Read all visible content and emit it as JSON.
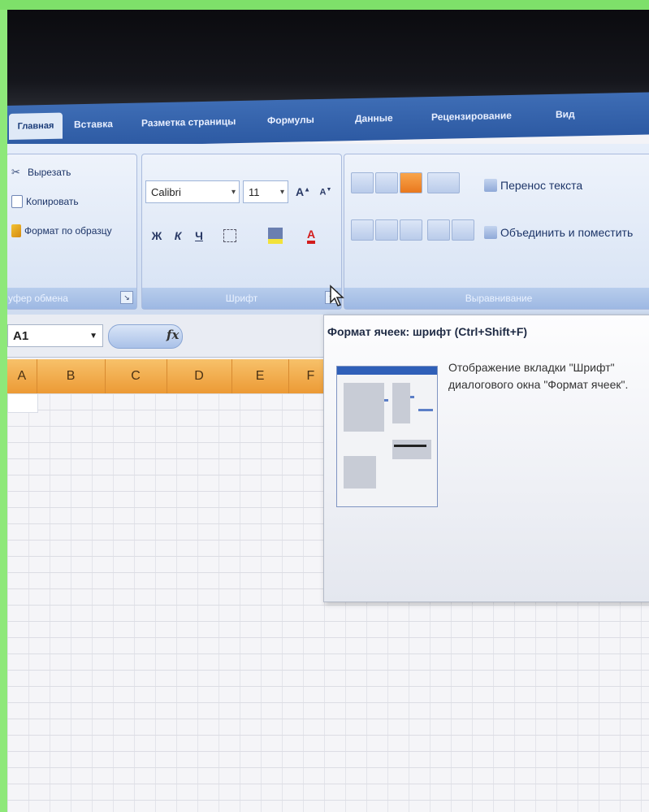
{
  "tabs": [
    {
      "label": "Главная",
      "active": true
    },
    {
      "label": "Вставка"
    },
    {
      "label": "Разметка страницы"
    },
    {
      "label": "Формулы"
    },
    {
      "label": "Данные"
    },
    {
      "label": "Рецензирование"
    },
    {
      "label": "Вид"
    }
  ],
  "clipboard": {
    "cut": "Вырезать",
    "copy": "Копировать",
    "format_painter": "Формат по образцу",
    "group_label": "уфер обмена"
  },
  "font": {
    "font_name": "Calibri",
    "font_size": "11",
    "group_label": "Шрифт",
    "bold": "Ж",
    "italic": "К",
    "underline": "Ч"
  },
  "alignment": {
    "wrap_text": "Перенос текста",
    "merge_center": "Объединить и поместить",
    "group_label": "Выравнивание"
  },
  "formula_bar": {
    "name_box": "A1",
    "fx": "fx"
  },
  "columns": [
    "A",
    "B",
    "C",
    "D",
    "E",
    "F"
  ],
  "tooltip": {
    "title": "Формат ячеек: шрифт (Ctrl+Shift+F)",
    "description": "Отображение вкладки \"Шрифт\" диалогового окна \"Формат ячеек\"."
  },
  "colors": {
    "accent": "#2d5aa3",
    "header_orange": "#ec9a35",
    "frame_green": "#8ee87a"
  }
}
